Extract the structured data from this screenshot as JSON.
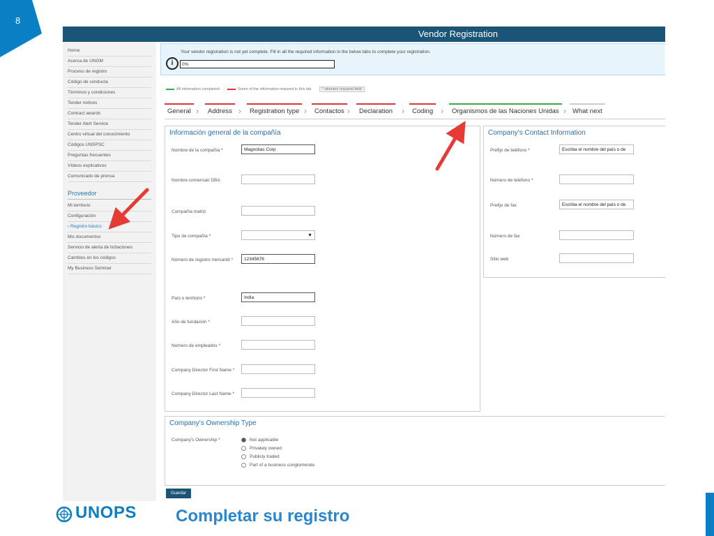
{
  "slide": {
    "page_number": "8",
    "title": "Completar su registro",
    "logo_text": "UNOPS"
  },
  "colors": {
    "accent_blue": "#0b7fc3",
    "header": "#1a5577",
    "tab_red": "#d9373a",
    "tab_green": "#3aaa48",
    "arrow": "#e53b34"
  },
  "app": {
    "title": "Vendor Registration",
    "alert": {
      "message": "Your vendor registration is not yet complete. Fill in all the required information in the below tabs to complete your registration.",
      "progress": "0%"
    },
    "legend": {
      "complete": "All information completed",
      "missing": "Some of the information required in this tab",
      "required": "* denotes required field"
    },
    "save_label": "Guardar"
  },
  "sidebar": {
    "items": [
      "Home",
      "Acerca de UNGM",
      "Proceso de registro",
      "Código de conducta",
      "Términos y condiciones",
      "Tender notices",
      "Contract awards",
      "Tender Alert Service",
      "Centro virtual del conocimiento",
      "Códigos UNSPSC",
      "Preguntas frecuentes",
      "Vídeos explicativos",
      "Comunicado de prensa"
    ],
    "section_title": "Proveedor",
    "vendor_items": [
      "Mi territorio",
      "Configuración",
      "Registro básico",
      "Mis documentos",
      "Servicio de alerta de licitaciones",
      "Cambios en los códigos",
      "My Business Seminar"
    ]
  },
  "tabs": [
    "General",
    "Address",
    "Registration type",
    "Contactos",
    "Declaration",
    "Coding",
    "Organismos de las Naciones Unidas",
    "What next"
  ],
  "general_info": {
    "title": "Información general de la compañía",
    "fields": [
      {
        "label": "Nombre de la compañía *",
        "value": "Magnolias Corp"
      },
      {
        "label": "Nombre comercial/ DBA",
        "value": ""
      },
      {
        "label": "Compañía matriz",
        "value": ""
      },
      {
        "label": "Tipo de compañía *",
        "value": ""
      },
      {
        "label": "Número de registro mercantil *",
        "value": "12345678"
      },
      {
        "label": "País o territorio *",
        "value": "India"
      },
      {
        "label": "Año de fundación *",
        "value": ""
      },
      {
        "label": "Número de empleados *",
        "value": ""
      },
      {
        "label": "Company Director First Name *",
        "value": ""
      },
      {
        "label": "Company Director Last Name *",
        "value": ""
      }
    ]
  },
  "contact_info": {
    "title": "Company's Contact Information",
    "fields": [
      {
        "label": "Prefijo de teléfono *",
        "value": "Escriba el nombre del país o de"
      },
      {
        "label": "Número de teléfono *",
        "value": ""
      },
      {
        "label": "Prefijo de fax",
        "value": "Escriba el nombre del país o de"
      },
      {
        "label": "Número de fax",
        "value": ""
      },
      {
        "label": "Sitio web",
        "value": ""
      }
    ]
  },
  "ownership": {
    "title": "Company's Ownership Type",
    "label": "Company's Ownership *",
    "options": [
      "Not applicable",
      "Privately owned",
      "Publicly traded",
      "Part of a business conglomerate"
    ]
  }
}
